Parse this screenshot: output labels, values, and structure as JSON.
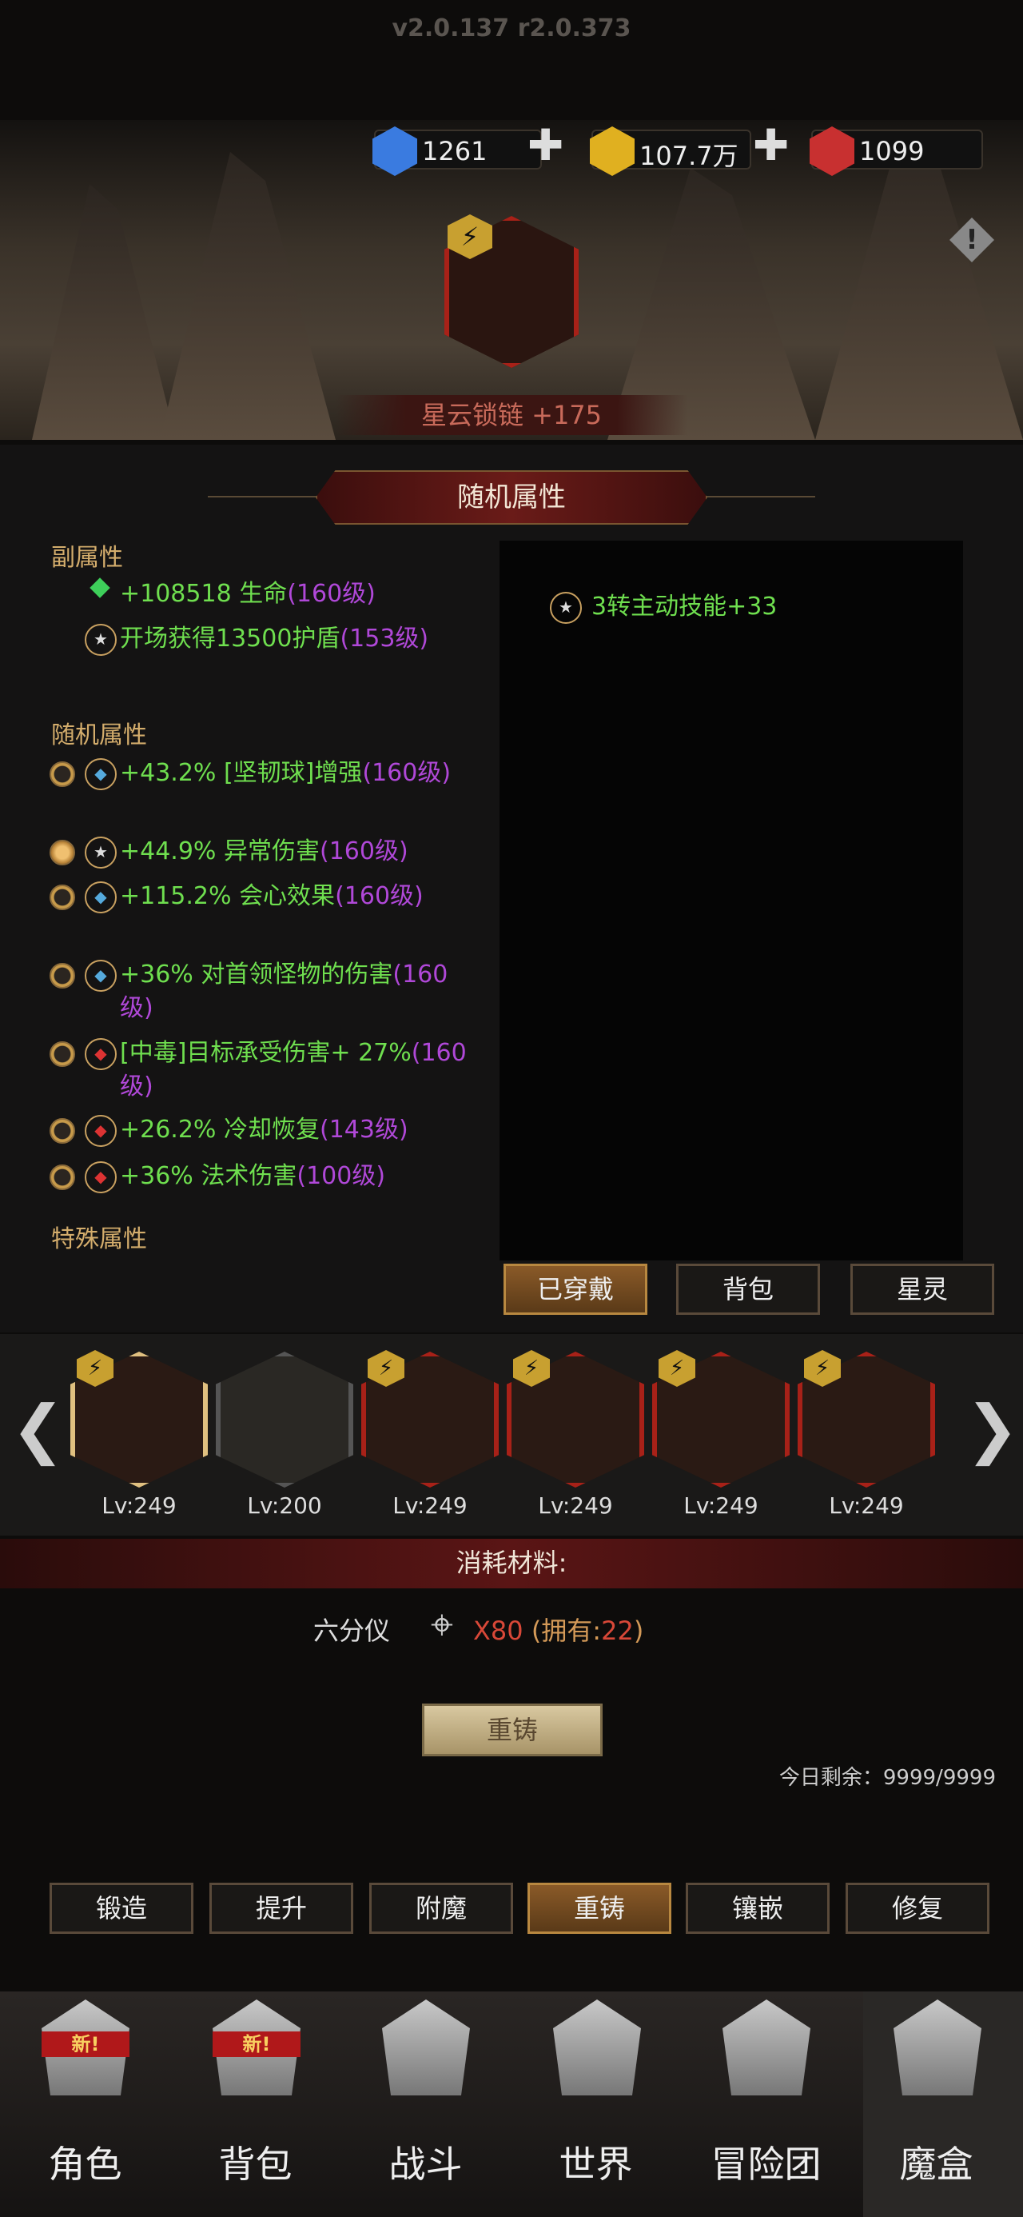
{
  "version": "v2.0.137 r2.0.373",
  "currency": [
    {
      "icon": "blue-gem-icon",
      "value": "1261",
      "plus": "✚",
      "color": "#3a7be0"
    },
    {
      "icon": "gold-coin-icon",
      "value": "107.7万",
      "plus": "✚",
      "color": "#e0b020"
    },
    {
      "icon": "red-gem-icon",
      "value": "1099",
      "color": "#c83030"
    }
  ],
  "item": {
    "name": "星云锁链 +175"
  },
  "section_title": "随机属性",
  "sub": {
    "label": "副属性",
    "stats": [
      {
        "text": "+108518 生命",
        "level": "(160级)"
      },
      {
        "text": "开场获得13500护盾",
        "level": "(153级)"
      }
    ]
  },
  "rand": {
    "label": "随机属性",
    "stats": [
      {
        "text": "+43.2% [坚韧球]增强",
        "level": "(160级)"
      },
      {
        "text": "+44.9% 异常伤害",
        "level": "(160级)"
      },
      {
        "text": "+115.2% 会心效果",
        "level": "(160级)"
      },
      {
        "text": "+36% 对首领怪物的伤害",
        "level": "(160级)"
      },
      {
        "text": "[中毒]目标承受伤害+ 27%",
        "level": "(160级)"
      },
      {
        "text": "+26.2% 冷却恢复",
        "level": "(143级)"
      },
      {
        "text": "+36% 法术伤害",
        "level": "(100级)"
      }
    ]
  },
  "special": {
    "label": "特殊属性"
  },
  "right": {
    "skill": "3转主动技能+33"
  },
  "view_tabs": [
    "已穿戴",
    "背包",
    "星灵"
  ],
  "equipment": [
    {
      "level": "Lv:249"
    },
    {
      "level": "Lv:200"
    },
    {
      "level": "Lv:249"
    },
    {
      "level": "Lv:249"
    },
    {
      "level": "Lv:249"
    },
    {
      "level": "Lv:249"
    }
  ],
  "arrows": {
    "left": "❮",
    "right": "❯"
  },
  "material": {
    "title": "消耗材料:",
    "name": "六分仪",
    "count": "X80",
    "owned_label": "(拥有:",
    "owned_value": "22",
    "owned_close": ")"
  },
  "recast": "重铸",
  "remaining": "今日剩余：9999/9999",
  "forge_tabs": [
    "锻造",
    "提升",
    "附魔",
    "重铸",
    "镶嵌",
    "修复"
  ],
  "new_tag": "新!",
  "nav": [
    "角色",
    "背包",
    "战斗",
    "世界",
    "冒险团",
    "魔盒"
  ]
}
